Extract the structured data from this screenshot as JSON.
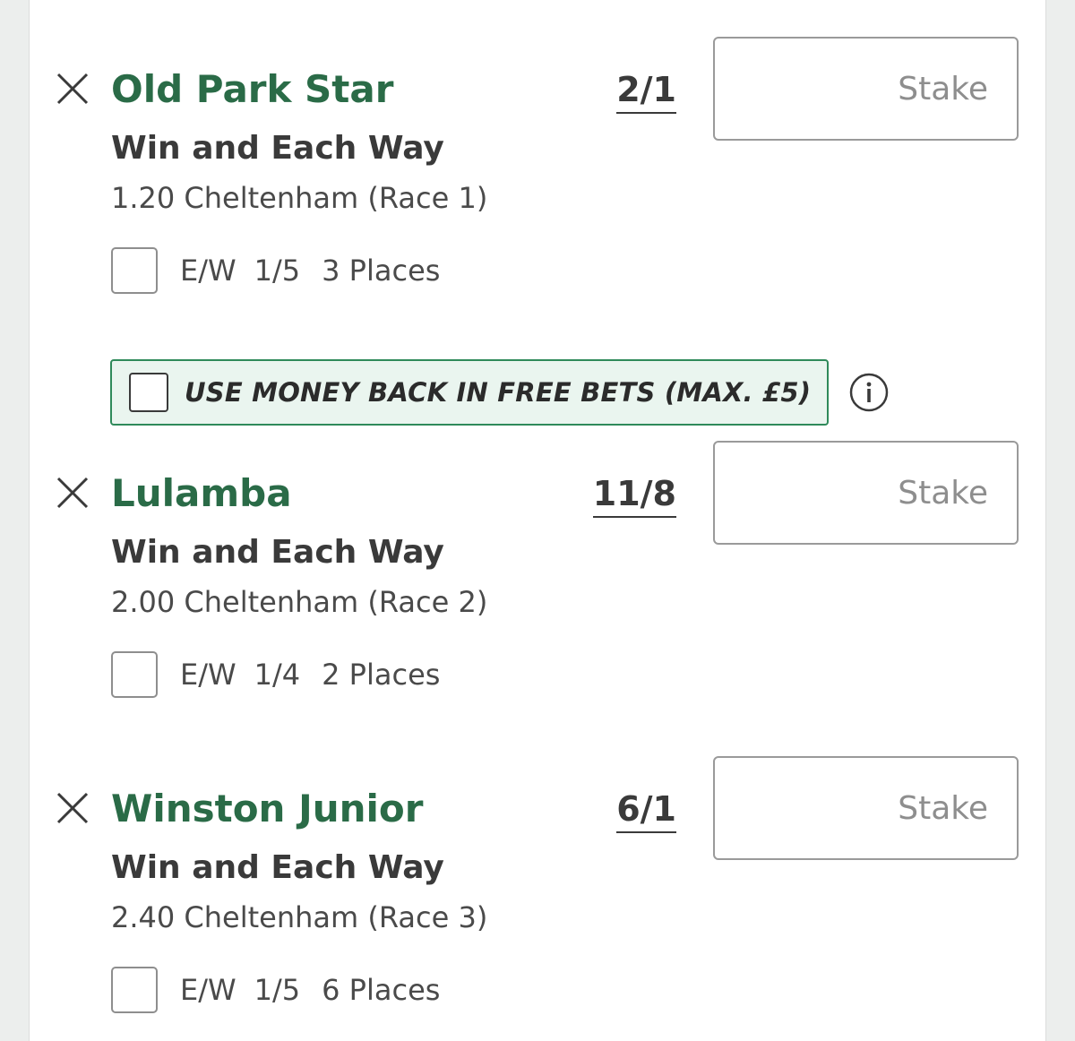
{
  "stake_placeholder": "Stake",
  "promo": {
    "label": "USE MONEY BACK IN FREE BETS (MAX. £5)",
    "checked": false
  },
  "bets": [
    {
      "selection": "Old Park Star",
      "odds": "2/1",
      "market": "Win and Each Way",
      "event": "1.20 Cheltenham (Race 1)",
      "ew": {
        "prefix": "E/W",
        "fraction": "1/5",
        "places": "3 Places",
        "checked": false
      }
    },
    {
      "selection": "Lulamba",
      "odds": "11/8",
      "market": "Win and Each Way",
      "event": "2.00 Cheltenham (Race 2)",
      "ew": {
        "prefix": "E/W",
        "fraction": "1/4",
        "places": "2 Places",
        "checked": false
      }
    },
    {
      "selection": "Winston Junior",
      "odds": "6/1",
      "market": "Win and Each Way",
      "event": "2.40 Cheltenham (Race 3)",
      "ew": {
        "prefix": "E/W",
        "fraction": "1/5",
        "places": "6 Places",
        "checked": false
      }
    }
  ],
  "colors": {
    "selection_name": "#2a6b47",
    "promo_border": "#2f8a5a",
    "promo_background": "#eaf5ef",
    "text_dark": "#3a3a3a"
  },
  "icons": {
    "remove": "close-icon",
    "info": "info-icon"
  }
}
